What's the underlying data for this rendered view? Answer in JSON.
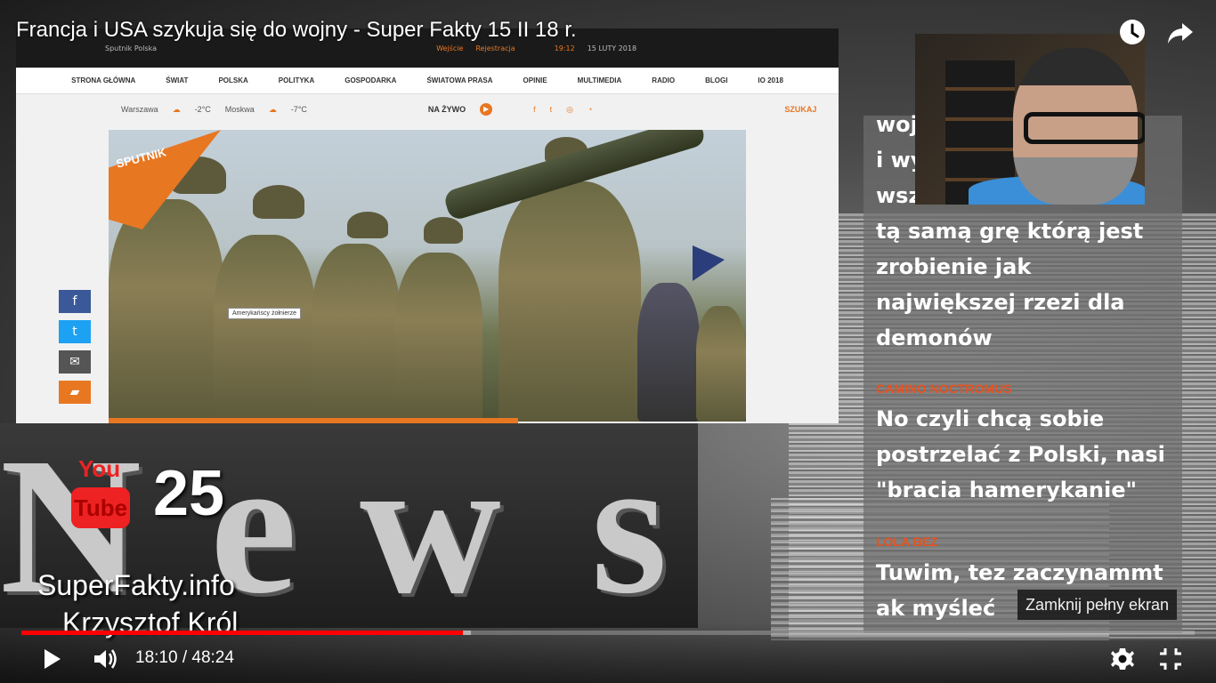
{
  "video": {
    "title": "Francja i USA szykuja się do wojny - Super Fakty 15 II 18 r.",
    "current_time": "18:10",
    "duration": "48:24",
    "time_display": "18:10 / 48:24",
    "progress_played": 0.376,
    "progress_loaded": 0.383,
    "tooltip": "Zamknij pełny ekran"
  },
  "top_icons": [
    "watch-later-icon",
    "share-icon"
  ],
  "embedded_site": {
    "top_bar": [
      "Sputnik Polska",
      "Wejście",
      "Rejestracja",
      "19:12",
      "15 LUTY 2018"
    ],
    "nav": [
      "STRONA GŁÓWNA",
      "ŚWIAT",
      "POLSKA",
      "POLITYKA",
      "GOSPODARKA",
      "ŚWIATOWA PRASA",
      "OPINIE",
      "MULTIMEDIA",
      "RADIO",
      "BLOGI",
      "IO 2018"
    ],
    "weather": [
      {
        "city": "Warszawa",
        "temp": "-2°C"
      },
      {
        "city": "Moskwa",
        "temp": "-7°C"
      }
    ],
    "live_label": "NA ŻYWO",
    "search_label": "SZUKAJ",
    "logo_text": "SPUTNIK",
    "photo_caption": "Amerykańscy żołnierze"
  },
  "share_buttons": [
    {
      "icon": "facebook-icon",
      "glyph": "f",
      "color": "#3b5998"
    },
    {
      "icon": "twitter-icon",
      "glyph": "t",
      "color": "#1da1f2"
    },
    {
      "icon": "email-icon",
      "glyph": "✉",
      "color": "#555555"
    },
    {
      "icon": "comment-icon",
      "glyph": "▰",
      "color": "#e87722"
    }
  ],
  "branding": {
    "news_word": "News",
    "youtube_you": "You",
    "youtube_tube": "Tube",
    "youtube_number": "25",
    "site": "SuperFakty.info",
    "author": "Krzysztof Król"
  },
  "chat": {
    "messages": [
      {
        "author": "",
        "lines": [
          "woj",
          "i wy",
          "wsz",
          "tą samą grę którą jest",
          "zrobienie jak",
          "największej rzezi dla",
          "demonów"
        ]
      },
      {
        "author": "CAMINO NOCTROMUS",
        "lines": [
          "No czyli chcą sobie",
          "postrzelać z Polski, nasi",
          "\"bracia hamerykanie\""
        ]
      },
      {
        "author": "LOLA BEZ",
        "lines": [
          "Tuwim, tez zaczynammt",
          "ak myśleć"
        ]
      }
    ]
  },
  "colors": {
    "progress": "#ff0000",
    "accent_orange": "#e87722",
    "chat_author": "#e8521f"
  }
}
